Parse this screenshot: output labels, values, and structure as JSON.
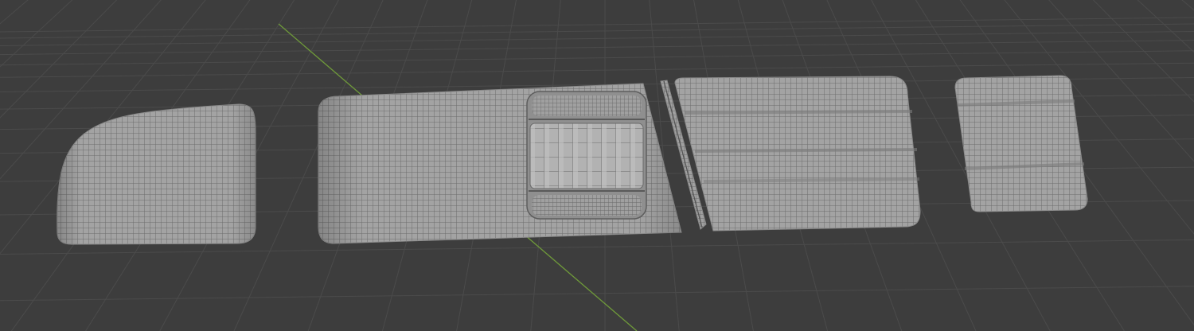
{
  "viewport": {
    "background_color": "#3d3d3d",
    "grid_color": "#4b4b4b",
    "y_axis_color": "#6f9a3a",
    "mesh_fill_color": "#a2a2a2",
    "wire_color": "#6c6c6c"
  },
  "objects": [
    {
      "name": "mesh-piece-curved-panel",
      "kind": "curved-panel"
    },
    {
      "name": "mesh-piece-long-panel-with-window",
      "kind": "panel-with-inset"
    },
    {
      "name": "mesh-piece-thin-strip",
      "kind": "strip"
    },
    {
      "name": "mesh-piece-ribbed-panel",
      "kind": "ribbed-panel"
    },
    {
      "name": "mesh-piece-small-ribbed-panel",
      "kind": "ribbed-panel"
    }
  ]
}
